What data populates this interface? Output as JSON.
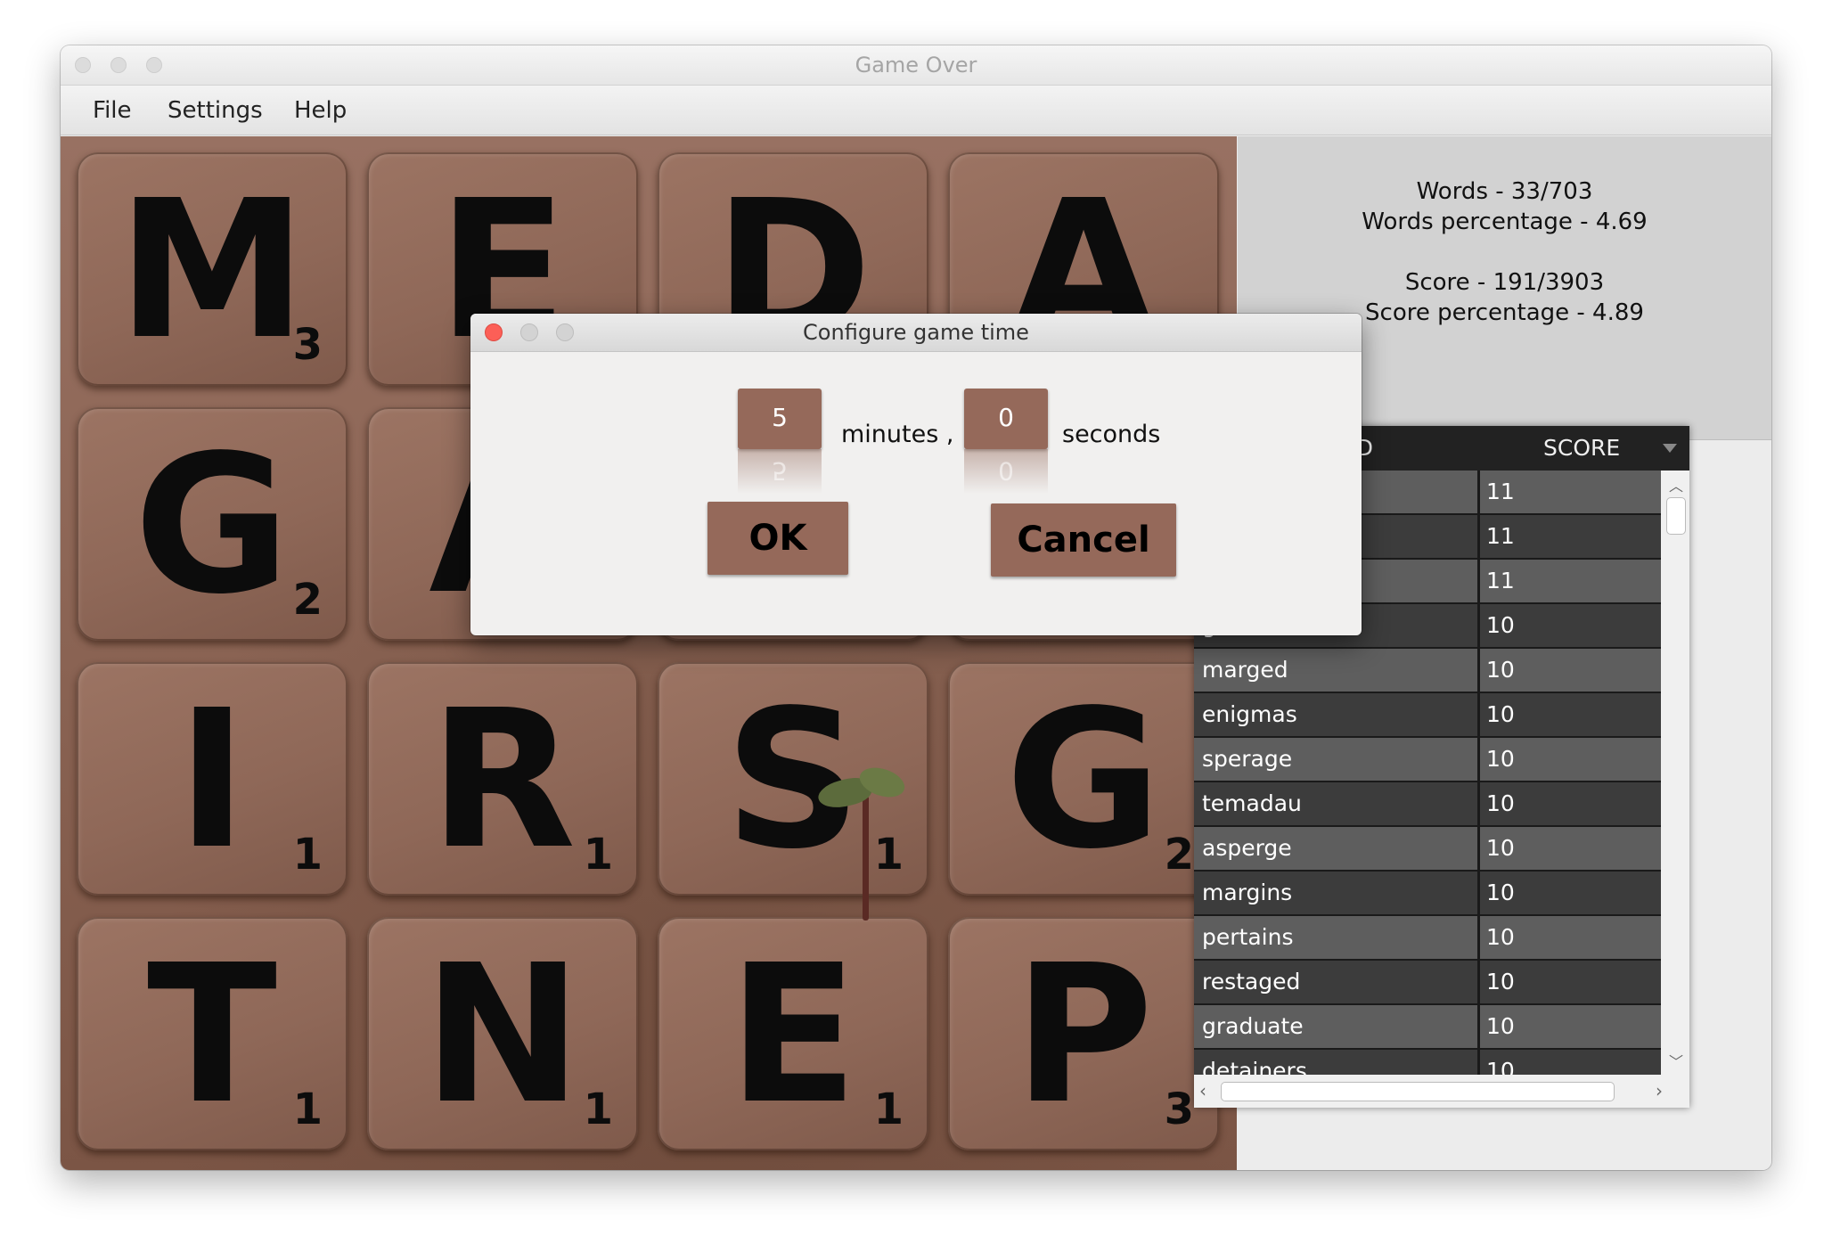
{
  "window": {
    "title": "Game Over"
  },
  "menu": {
    "file": "File",
    "settings": "Settings",
    "help": "Help"
  },
  "board": {
    "tiles": [
      {
        "letter": "M",
        "points": "3"
      },
      {
        "letter": "E",
        "points": ""
      },
      {
        "letter": "D",
        "points": ""
      },
      {
        "letter": "A",
        "points": ""
      },
      {
        "letter": "G",
        "points": "2"
      },
      {
        "letter": "A",
        "points": ""
      },
      {
        "letter": "",
        "points": ""
      },
      {
        "letter": "",
        "points": ""
      },
      {
        "letter": "I",
        "points": "1"
      },
      {
        "letter": "R",
        "points": "1"
      },
      {
        "letter": "S",
        "points": "1"
      },
      {
        "letter": "G",
        "points": "2"
      },
      {
        "letter": "T",
        "points": "1"
      },
      {
        "letter": "N",
        "points": "1"
      },
      {
        "letter": "E",
        "points": "1"
      },
      {
        "letter": "P",
        "points": "3"
      }
    ]
  },
  "stats": {
    "words": "Words - 33/703",
    "words_pct": "Words percentage - 4.69",
    "score": "Score - 191/3903",
    "score_pct": "Score percentage - 4.89"
  },
  "table": {
    "col_word": "WORD",
    "col_score": "SCORE",
    "rows": [
      {
        "word": "",
        "score": "11"
      },
      {
        "word": "",
        "score": "11"
      },
      {
        "word": "",
        "score": "11"
      },
      {
        "word": "gudame",
        "score": "10"
      },
      {
        "word": "marged",
        "score": "10"
      },
      {
        "word": "enigmas",
        "score": "10"
      },
      {
        "word": "sperage",
        "score": "10"
      },
      {
        "word": "temadau",
        "score": "10"
      },
      {
        "word": "asperge",
        "score": "10"
      },
      {
        "word": "margins",
        "score": "10"
      },
      {
        "word": "pertains",
        "score": "10"
      },
      {
        "word": "restaged",
        "score": "10"
      },
      {
        "word": "graduate",
        "score": "10"
      },
      {
        "word": "detainers",
        "score": "10"
      }
    ]
  },
  "dialog": {
    "title": "Configure game time",
    "minutes_value": "5",
    "minutes_label": "minutes ,",
    "seconds_value": "0",
    "seconds_label": "seconds",
    "ok": "OK",
    "cancel": "Cancel"
  },
  "colors": {
    "accent": "#95695a",
    "table_row_light": "#5e5e5e",
    "table_row_dark": "#3c3c3c"
  }
}
